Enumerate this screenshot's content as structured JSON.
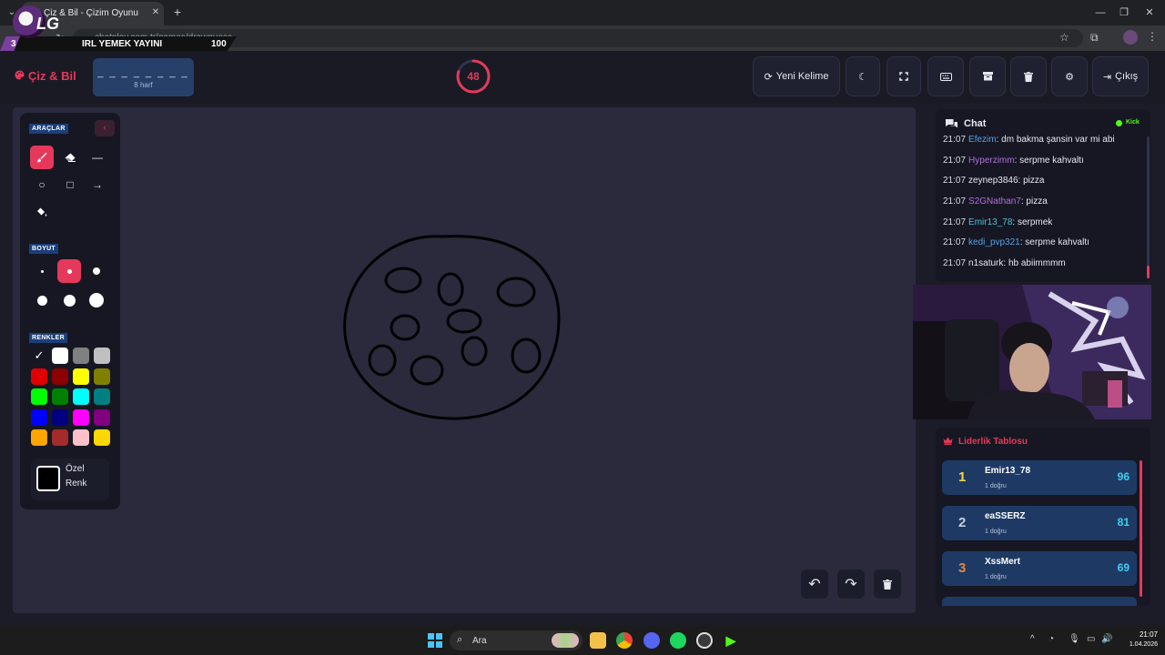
{
  "browser": {
    "tab_title": "Çiz & Bil - Çizim Oyunu",
    "tab_close": "✕",
    "new_tab": "+",
    "url": "chatplay.com.tr/games/drawguess",
    "window_min": "—",
    "window_max": "❐",
    "window_close": "✕"
  },
  "stream_overlay": {
    "logo_text": "LG",
    "count": "3",
    "title": "IRL YEMEK YAYINI",
    "viewers": "100"
  },
  "header": {
    "brand": "Çiz & Bil",
    "word_dashes": "_ _ _ _ _ _ _ _",
    "word_length": "8 harf",
    "timer": "48",
    "timer_fraction": 0.8,
    "buttons": {
      "new_word": "Yeni Kelime",
      "exit": "Çıkış"
    }
  },
  "tools": {
    "section_tools": "ARAÇLAR",
    "section_size": "BOYUT",
    "section_colors": "RENKLER",
    "custom_color_line1": "Özel",
    "custom_color_line2": "Renk",
    "active_tool": "brush",
    "active_size_index": 1,
    "colors": [
      "#000000",
      "#ffffff",
      "#808080",
      "#c0c0c0",
      "#e00000",
      "#8b0000",
      "#ffff00",
      "#808000",
      "#00ff00",
      "#008000",
      "#00ffff",
      "#008080",
      "#0000ff",
      "#000080",
      "#ff00ff",
      "#800080",
      "#ffa500",
      "#a52a2a",
      "#ffc0cb",
      "#ffd700"
    ],
    "selected_color": "#000000"
  },
  "chat": {
    "title": "Chat",
    "platform": "Kick",
    "messages": [
      {
        "time": "21:07",
        "user": "Efezim",
        "user_color": "#5aa0e6",
        "text": ": dm bakma şansin var mi abi"
      },
      {
        "time": "21:07",
        "user": "Hyperzimm",
        "user_color": "#b070e0",
        "text": ": serpme kahvaltı"
      },
      {
        "time": "21:07",
        "user": "zeynep3846",
        "user_color": "#e6e8f0",
        "text": ": pizza"
      },
      {
        "time": "21:07",
        "user": "S2GNathan7",
        "user_color": "#b070e0",
        "text": ": pizza"
      },
      {
        "time": "21:07",
        "user": "Emir13_78",
        "user_color": "#4fc3d8",
        "text": ": serpmek"
      },
      {
        "time": "21:07",
        "user": "kedi_pvp321",
        "user_color": "#5aa0e6",
        "text": ": serpme kahvaltı"
      },
      {
        "time": "21:07",
        "user": "n1saturk",
        "user_color": "#e6e8f0",
        "text": ": hb abiimmmm"
      }
    ]
  },
  "leaderboard": {
    "title": "Liderlik Tablosu",
    "rows": [
      {
        "rank": "1",
        "rank_color": "#f5d742",
        "name": "Emir13_78",
        "sub": "1 doğru",
        "score": "96"
      },
      {
        "rank": "2",
        "rank_color": "#c8d0dc",
        "name": "eaSSERZ",
        "sub": "1 doğru",
        "score": "81"
      },
      {
        "rank": "3",
        "rank_color": "#e0883a",
        "name": "XssMert",
        "sub": "1 doğru",
        "score": "69"
      }
    ]
  },
  "taskbar": {
    "search_placeholder": "Ara",
    "time": "21:07",
    "date": "1.04.2026"
  },
  "colors": {
    "accent": "#e5395b",
    "panel": "#161722",
    "canvas": "#2a2a3c"
  }
}
